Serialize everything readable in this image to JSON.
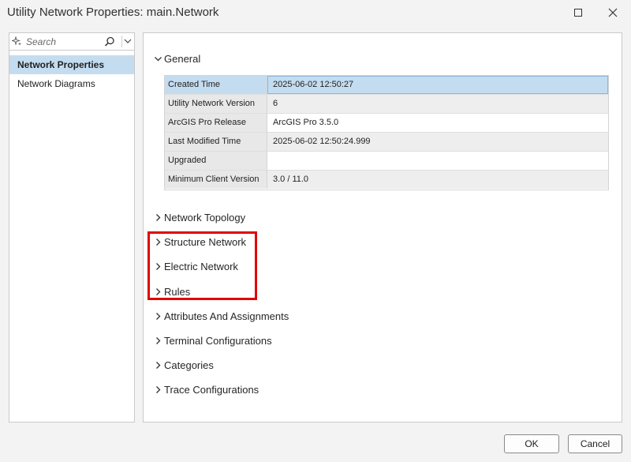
{
  "window": {
    "title": "Utility Network Properties: main.Network"
  },
  "search": {
    "placeholder": "Search"
  },
  "nav": {
    "items": [
      {
        "label": "Network Properties",
        "selected": true
      },
      {
        "label": "Network Diagrams",
        "selected": false
      }
    ]
  },
  "general": {
    "label": "General",
    "rows": [
      {
        "key": "Created Time",
        "value": "2025-06-02 12:50:27"
      },
      {
        "key": "Utility Network Version",
        "value": "6"
      },
      {
        "key": "ArcGIS Pro Release",
        "value": "ArcGIS Pro 3.5.0"
      },
      {
        "key": "Last Modified Time",
        "value": "2025-06-02 12:50:24.999"
      },
      {
        "key": "Upgraded",
        "value": ""
      },
      {
        "key": "Minimum Client Version",
        "value": "3.0 / 11.0"
      }
    ]
  },
  "sections": {
    "network_topology": "Network Topology",
    "structure_network": "Structure Network",
    "electric_network": "Electric Network",
    "rules": "Rules",
    "attributes_assignments": "Attributes And Assignments",
    "terminal_configurations": "Terminal Configurations",
    "categories": "Categories",
    "trace_configurations": "Trace Configurations"
  },
  "buttons": {
    "ok": "OK",
    "cancel": "Cancel"
  },
  "colors": {
    "selection": "#c4dcf0",
    "highlight": "#e10000"
  }
}
